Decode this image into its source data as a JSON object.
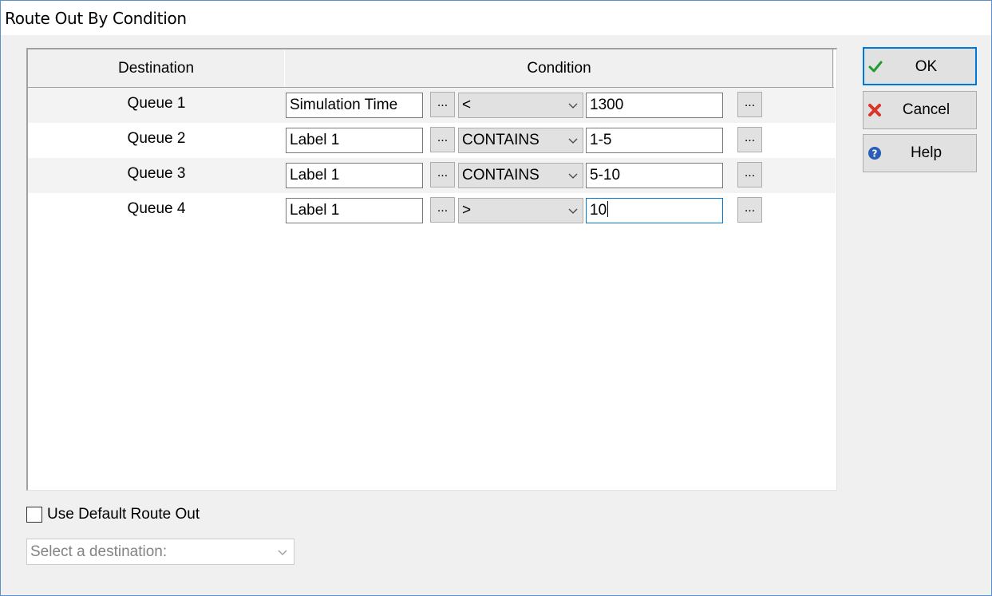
{
  "window": {
    "title": "Route Out By Condition"
  },
  "grid": {
    "headers": {
      "destination": "Destination",
      "condition": "Condition"
    },
    "rows": [
      {
        "destination": "Queue 1",
        "variable": "Simulation Time",
        "operator": "<",
        "value": "1300"
      },
      {
        "destination": "Queue 2",
        "variable": "Label 1",
        "operator": "CONTAINS",
        "value": "1-5"
      },
      {
        "destination": "Queue 3",
        "variable": "Label 1",
        "operator": "CONTAINS",
        "value": "5-10"
      },
      {
        "destination": "Queue 4",
        "variable": "Label 1",
        "operator": ">",
        "value": "10"
      }
    ],
    "browse_label": "..."
  },
  "buttons": {
    "ok": {
      "label": "OK",
      "icon": "checkmark-icon",
      "icon_color": "#1f9d2f"
    },
    "cancel": {
      "label": "Cancel",
      "icon": "x-icon",
      "icon_color": "#d9352b"
    },
    "help": {
      "label": "Help",
      "icon": "help-icon",
      "icon_color": "#2a5cb8"
    }
  },
  "default_route": {
    "checkbox_label": "Use Default Route Out",
    "checked": false,
    "select_placeholder": "Select a destination:"
  },
  "colors": {
    "focus": "#0078d7",
    "button_face": "#e1e1e1",
    "dialog_bg": "#f0f0f0"
  }
}
